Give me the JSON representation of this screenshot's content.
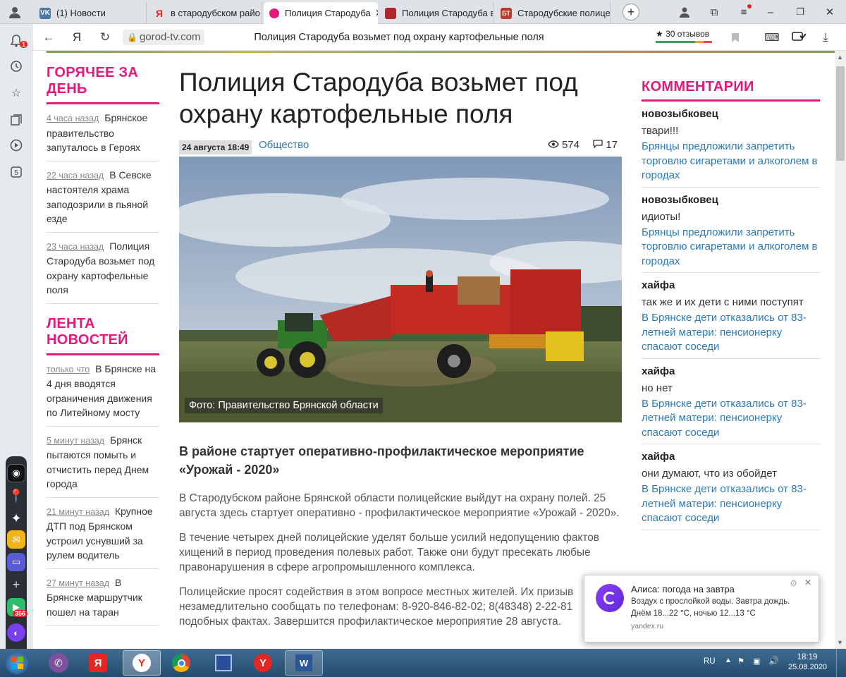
{
  "browser": {
    "tabs": [
      {
        "label": "(1) Новости",
        "favicon": "VK"
      },
      {
        "label": "в стародубском райо",
        "favicon": "Я"
      },
      {
        "label": "Полиция Стародуба",
        "favicon": "",
        "active": true
      },
      {
        "label": "Полиция Стародуба в",
        "favicon": ""
      },
      {
        "label": "Стародубские полице",
        "favicon": "БТ"
      }
    ],
    "address": "gorod-tv.com",
    "page_title": "Полиция Стародуба возьмет под охрану картофельные поля",
    "reviews_label": "30 отзывов",
    "yandex_logo": "Я"
  },
  "sidebar": {
    "badge_top": "1",
    "badge_app": "356"
  },
  "hot": {
    "title": "Горячее за день",
    "items": [
      {
        "time": "4 часа назад",
        "text": "Брянское правительство запуталось в Героях"
      },
      {
        "time": "22 часа назад",
        "text": "В Севске настоятеля храма заподозрили в пьяной езде"
      },
      {
        "time": "23 часа назад",
        "text": "Полиция Стародуба возьмет под охрану картофельные поля"
      }
    ]
  },
  "feed": {
    "title": "Лента новостей",
    "items": [
      {
        "time": "только что",
        "text": "В Брянске на 4 дня вводятся ограничения движения по Литейному мосту"
      },
      {
        "time": "5 минут назад",
        "text": "Брянск пытаются помыть и отчистить перед Днем города"
      },
      {
        "time": "21 минут назад",
        "text": "Крупное ДТП под Брянском устроил уснувший за рулем водитель"
      },
      {
        "time": "27 минут назад",
        "text": "В Брянске маршрутчик пошел на таран"
      }
    ]
  },
  "article": {
    "title": "Полиция Стародуба возьмет под охрану картофельные поля",
    "date": "24 августа 18:49",
    "rubric": "Общество",
    "views": "574",
    "comments": "17",
    "photo_caption": "Фото: Правительство Брянской области",
    "lead": "В районе стартует оперативно-профилактическое мероприятие «Урожай - 2020»",
    "paragraphs": [
      "В Стародубском районе Брянской области полицейские выйдут на охрану полей. 25 августа здесь стартует оперативно - профилактическое мероприятие «Урожай - 2020».",
      "В течение четырех дней полицейские уделят больше усилий недопущению фактов хищений в период проведения полевых работ. Также они будут пресекать любые правонарушения в сфере агропромышленного комплекса.",
      "Полицейские просят содействия в этом вопросе местных жителей. Их призыв незамедлительно сообщать по телефонам: 8-920-846-82-02; 8(48348) 2-22-81 подобных фактах. Завершится профилактическое мероприятие 28 августа."
    ]
  },
  "comments": {
    "title": "Комментарии",
    "items": [
      {
        "author": "новозыбковец",
        "text": "твари!!!",
        "link": "Брянцы предложили запретить торговлю сигаретами и алкоголем в городах"
      },
      {
        "author": "новозыбковец",
        "text": "идиоты!",
        "link": "Брянцы предложили запретить торговлю сигаретами и алкоголем в городах"
      },
      {
        "author": "хайфа",
        "text": "так же и их дети с ними поступят",
        "link": "В Брянске дети отказались от 83-летней матери: пенсионерку спасают соседи"
      },
      {
        "author": "хайфа",
        "text": "но нет",
        "link": "В Брянске дети отказались от 83-летней матери: пенсионерку спасают соседи"
      },
      {
        "author": "хайфа",
        "text": "они думают, что из обойдет",
        "link": "В Брянске дети отказались от 83-летней матери: пенсионерку спасают соседи"
      }
    ]
  },
  "notification": {
    "title": "Алиса: погода на завтра",
    "line1": "Воздух с прослойкой воды. Завтра дождь.",
    "line2": "Днём 18...22 °C, ночью 12...13 °C",
    "source": "yandex.ru"
  },
  "taskbar": {
    "lang": "RU",
    "time": "18:19",
    "date": "25.08.2020"
  },
  "colors": {
    "accent": "#e5197b",
    "link": "#2a7ab9"
  }
}
